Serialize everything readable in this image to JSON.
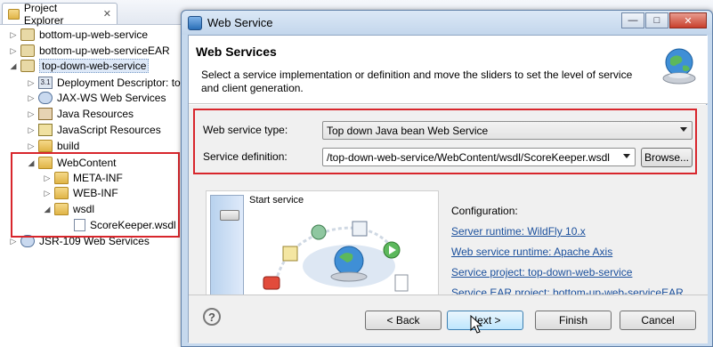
{
  "project_explorer": {
    "tab_title": "Project Explorer",
    "close_glyph": "✕",
    "tree": [
      {
        "label": "bottom-up-web-service",
        "depth": 0,
        "twisty": "▷",
        "icon": "project-icon"
      },
      {
        "label": "bottom-up-web-serviceEAR",
        "depth": 0,
        "twisty": "▷",
        "icon": "project-icon"
      },
      {
        "label": "top-down-web-service",
        "depth": 0,
        "twisty": "◢",
        "icon": "project-icon",
        "selected": true
      },
      {
        "label": "Deployment Descriptor: to",
        "depth": 1,
        "twisty": "▷",
        "icon": "descriptor-icon"
      },
      {
        "label": "JAX-WS Web Services",
        "depth": 1,
        "twisty": "▷",
        "icon": "jaxws-icon"
      },
      {
        "label": "Java Resources",
        "depth": 1,
        "twisty": "▷",
        "icon": "java-resources-icon"
      },
      {
        "label": "JavaScript Resources",
        "depth": 1,
        "twisty": "▷",
        "icon": "javascript-resources-icon"
      },
      {
        "label": "build",
        "depth": 1,
        "twisty": "▷",
        "icon": "folder-icon"
      },
      {
        "label": "WebContent",
        "depth": 1,
        "twisty": "◢",
        "icon": "folder-icon"
      },
      {
        "label": "META-INF",
        "depth": 2,
        "twisty": "▷",
        "icon": "folder-icon"
      },
      {
        "label": "WEB-INF",
        "depth": 2,
        "twisty": "▷",
        "icon": "folder-icon"
      },
      {
        "label": "wsdl",
        "depth": 2,
        "twisty": "◢",
        "icon": "folder-icon"
      },
      {
        "label": "ScoreKeeper.wsdl",
        "depth": 3,
        "twisty": "",
        "icon": "wsdl-file-icon"
      },
      {
        "label": "JSR-109 Web Services",
        "depth": 0,
        "twisty": "▷",
        "icon": "jaxws-icon"
      }
    ]
  },
  "dialog": {
    "title": "Web Service",
    "window_buttons": {
      "minimize": "—",
      "maximize": "□",
      "close": "✕"
    },
    "header": {
      "heading": "Web Services",
      "description": "Select a service implementation or definition and move the sliders to set the level of service and client generation."
    },
    "form": {
      "service_type_label": "Web service type:",
      "service_type_value": "Top down Java bean Web Service",
      "service_definition_label": "Service definition:",
      "service_definition_value": "/top-down-web-service/WebContent/wsdl/ScoreKeeper.wsdl",
      "browse_button": "Browse..."
    },
    "slider": {
      "label": "Start service"
    },
    "configuration": {
      "heading": "Configuration:",
      "links": [
        "Server runtime: WildFly 10.x",
        "Web service runtime: Apache Axis",
        "Service project: top-down-web-service",
        "Service EAR project: bottom-up-web-serviceEAR"
      ]
    },
    "footer": {
      "help_glyph": "?",
      "back_button": "< Back",
      "next_button": "Next >",
      "finish_button": "Finish",
      "cancel_button": "Cancel"
    }
  }
}
